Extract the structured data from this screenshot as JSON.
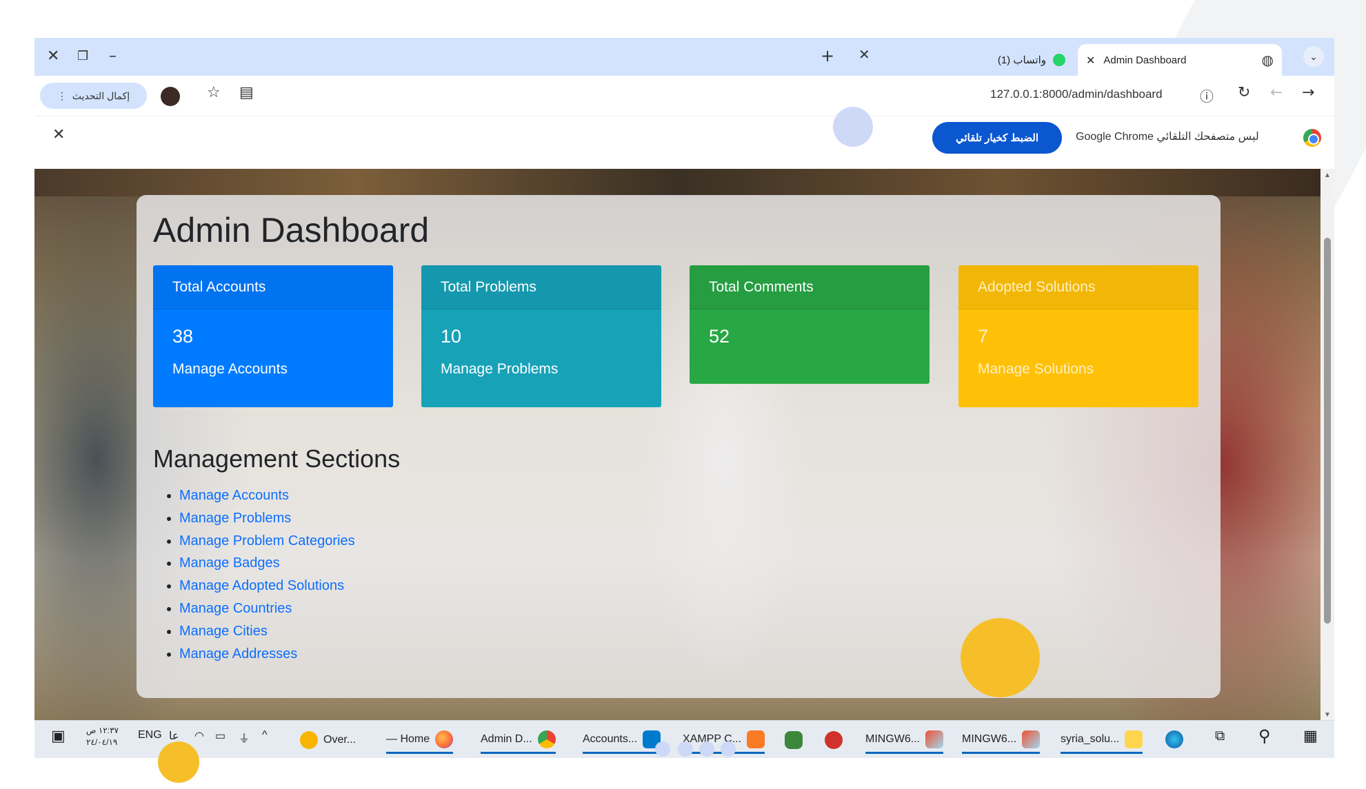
{
  "browser": {
    "tabs": [
      {
        "label": "Admin Dashboard",
        "active": true
      },
      {
        "label": "(1) واتساب",
        "active": false
      }
    ],
    "url": "127.0.0.1:8000/admin/dashboard",
    "update_button": "إكمال التحديث",
    "infobar": {
      "message": "Google Chrome ليس متصفحك التلقائي",
      "default_button": "الضبط كخيار تلقائي"
    }
  },
  "dashboard": {
    "title": "Admin Dashboard",
    "cards": [
      {
        "header": "Total Accounts",
        "count": "38",
        "link": "Manage Accounts",
        "color": "#007bff"
      },
      {
        "header": "Total Problems",
        "count": "10",
        "link": "Manage Problems",
        "color": "#17a2b8"
      },
      {
        "header": "Total Comments",
        "count": "52",
        "link": "",
        "color": "#28a745"
      },
      {
        "header": "Adopted Solutions",
        "count": "7",
        "link": "Manage Solutions",
        "color": "#ffc107"
      }
    ],
    "sections_title": "Management Sections",
    "sections": [
      "Manage Accounts",
      "Manage Problems",
      "Manage Problem Categories",
      "Manage Badges",
      "Manage Adopted Solutions",
      "Manage Countries",
      "Manage Cities",
      "Manage Addresses"
    ]
  },
  "taskbar": {
    "language": "ENG",
    "ime": "عا",
    "time": "١٢:٣٧ ص",
    "date": "٢٤/٠٤/١٩",
    "apps": [
      {
        "label": "Over...",
        "icon": "overleaf-icon"
      },
      {
        "label": "— Home",
        "icon": "firefox-icon"
      },
      {
        "label": "Admin D...",
        "icon": "chrome-icon"
      },
      {
        "label": "Accounts...",
        "icon": "vscode-icon"
      },
      {
        "label": "XAMPP C...",
        "icon": "xampp-icon"
      },
      {
        "label": "",
        "icon": "node-icon"
      },
      {
        "label": "",
        "icon": "p-app-icon"
      },
      {
        "label": "MINGW6...",
        "icon": "git-icon"
      },
      {
        "label": "MINGW6...",
        "icon": "git-icon"
      },
      {
        "label": "syria_solu...",
        "icon": "folder-icon"
      }
    ]
  }
}
